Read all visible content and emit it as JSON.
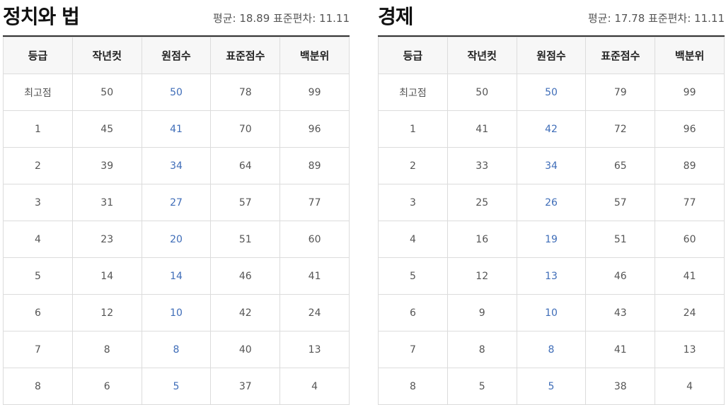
{
  "headers": [
    "등급",
    "작년컷",
    "원점수",
    "표준점수",
    "백분위"
  ],
  "panels": [
    {
      "title": "정치와 법",
      "stats": "평균: 18.89 표준편차: 11.11",
      "rows": [
        [
          "최고점",
          "50",
          "50",
          "78",
          "99"
        ],
        [
          "1",
          "45",
          "41",
          "70",
          "96"
        ],
        [
          "2",
          "39",
          "34",
          "64",
          "89"
        ],
        [
          "3",
          "31",
          "27",
          "57",
          "77"
        ],
        [
          "4",
          "23",
          "20",
          "51",
          "60"
        ],
        [
          "5",
          "14",
          "14",
          "46",
          "41"
        ],
        [
          "6",
          "12",
          "10",
          "42",
          "24"
        ],
        [
          "7",
          "8",
          "8",
          "40",
          "13"
        ],
        [
          "8",
          "6",
          "5",
          "37",
          "4"
        ]
      ]
    },
    {
      "title": "경제",
      "stats": "평균: 17.78 표준편차: 11.11",
      "rows": [
        [
          "최고점",
          "50",
          "50",
          "79",
          "99"
        ],
        [
          "1",
          "41",
          "42",
          "72",
          "96"
        ],
        [
          "2",
          "33",
          "34",
          "65",
          "89"
        ],
        [
          "3",
          "25",
          "26",
          "57",
          "77"
        ],
        [
          "4",
          "16",
          "19",
          "51",
          "60"
        ],
        [
          "5",
          "12",
          "13",
          "46",
          "41"
        ],
        [
          "6",
          "9",
          "10",
          "43",
          "24"
        ],
        [
          "7",
          "8",
          "8",
          "41",
          "13"
        ],
        [
          "8",
          "5",
          "5",
          "38",
          "4"
        ]
      ]
    }
  ],
  "colors": {
    "raw_score": "#3f6db8",
    "header_bg": "#f7f7f7",
    "border": "#dcdcdc"
  }
}
